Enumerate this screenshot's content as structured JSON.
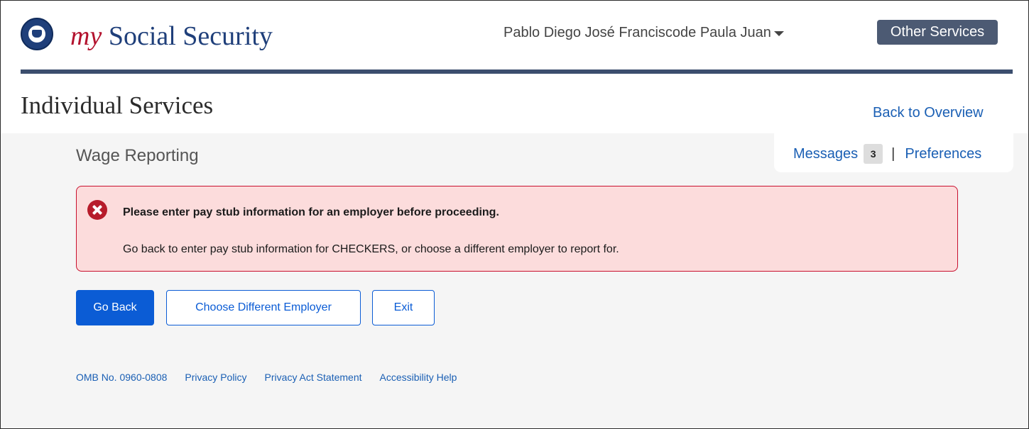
{
  "header": {
    "logo_my": "my",
    "logo_rest": " Social Security",
    "user_name": "Pablo Diego José Franciscode Paula Juan",
    "other_services_label": "Other Services"
  },
  "page": {
    "title": "Individual Services",
    "back_link": "Back  to Overview",
    "messages_label": "Messages",
    "messages_count": "3",
    "separator": "|",
    "preferences_label": "Preferences",
    "section_title": "Wage Reporting"
  },
  "alert": {
    "title": "Please enter pay stub information for an employer before proceeding.",
    "body": "Go back to enter pay stub information for CHECKERS, or choose a different employer to report for."
  },
  "actions": {
    "go_back": "Go Back",
    "choose_employer": "Choose Different Employer",
    "exit": "Exit"
  },
  "footer": {
    "omb": "OMB No. 0960-0808",
    "privacy_policy": "Privacy Policy",
    "privacy_act": "Privacy Act Statement",
    "accessibility": "Accessibility Help"
  },
  "colors": {
    "brand_navy": "#1f3f7a",
    "brand_red": "#b3122e",
    "link_blue": "#1a5fb4",
    "primary_button": "#0b5cd5",
    "alert_bg": "#fcdcdc",
    "alert_border": "#c8102e"
  },
  "icons": {
    "logo": "ssa-seal-icon",
    "caret": "chevron-down-icon",
    "alert": "error-x-circle-icon"
  }
}
